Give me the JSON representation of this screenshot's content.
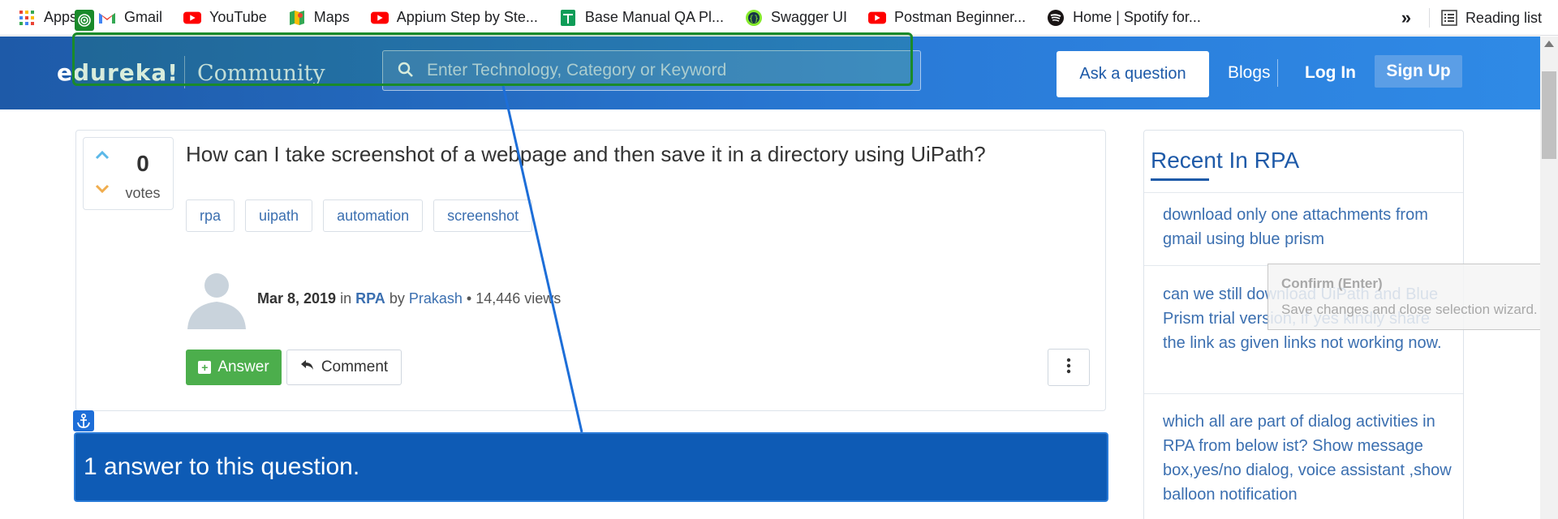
{
  "bookmarks": {
    "items": [
      {
        "label": "Apps",
        "icon": "apps-grid-icon"
      },
      {
        "label": "Gmail",
        "icon": "gmail-icon"
      },
      {
        "label": "YouTube",
        "icon": "youtube-icon"
      },
      {
        "label": "Maps",
        "icon": "maps-icon"
      },
      {
        "label": "Appium Step by Ste...",
        "icon": "youtube-icon"
      },
      {
        "label": "Base Manual QA Pl...",
        "icon": "sheets-icon"
      },
      {
        "label": "Swagger UI",
        "icon": "swagger-icon"
      },
      {
        "label": "Postman Beginner...",
        "icon": "youtube-icon"
      },
      {
        "label": "Home | Spotify for...",
        "icon": "spotify-icon"
      }
    ],
    "overflow": "»",
    "reading_list": "Reading list"
  },
  "header": {
    "logo": "edureka!",
    "community": "Community",
    "search_placeholder": "Enter Technology, Category or Keyword",
    "ask_label": "Ask a question",
    "blogs_label": "Blogs",
    "login_label": "Log In",
    "signup_label": "Sign Up"
  },
  "question": {
    "votes": "0",
    "votes_label": "votes",
    "title": "How can I take screenshot of a webpage and then save it in a directory using UiPath?",
    "tags": [
      "rpa",
      "uipath",
      "automation",
      "screenshot"
    ],
    "date": "Mar 8, 2019",
    "in_word": "in",
    "category": "RPA",
    "by_word": "by",
    "author": "Prakash",
    "views": "• 14,446 views",
    "answer_label": "Answer",
    "comment_label": "Comment"
  },
  "answers": {
    "heading": "1 answer to this question."
  },
  "sidebar": {
    "title": "Recent In RPA",
    "items": [
      "download only one attachments from gmail using blue prism",
      "can we still download UiPath and Blue Prism trial version, if yes kindly share the link as given links not working now.",
      "which all are part of dialog activities in RPA from below ist? Show message box,yes/no dialog, voice assistant ,show balloon notification"
    ]
  },
  "tooltip": {
    "title": "Confirm (Enter)",
    "description": "Save changes and close selection wizard."
  },
  "colors": {
    "brand_blue": "#1e5aa8",
    "answer_green": "#4cae4c",
    "selection_green": "#1a8a2a",
    "anchor_blue": "#1d6ed8"
  }
}
